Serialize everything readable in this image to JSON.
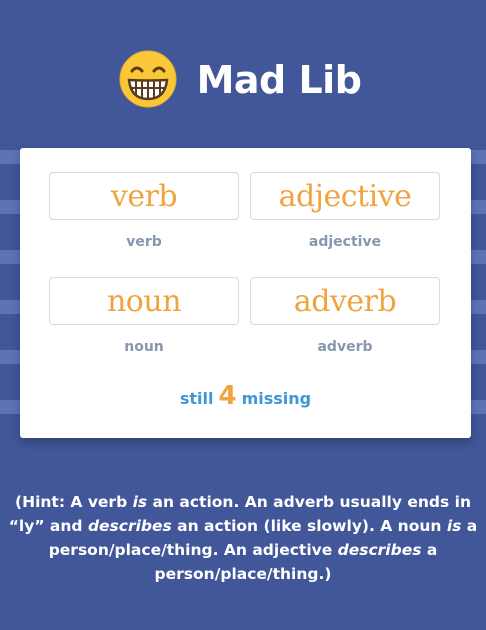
{
  "header": {
    "icon": "grinning-face-icon",
    "title": "Mad Lib"
  },
  "fields": [
    {
      "value": "verb",
      "label": "verb"
    },
    {
      "value": "adjective",
      "label": "adjective"
    },
    {
      "value": "noun",
      "label": "noun"
    },
    {
      "value": "adverb",
      "label": "adverb"
    }
  ],
  "status": {
    "prefix": "still",
    "count": "4",
    "suffix": "missing"
  },
  "hint": {
    "s1": "(Hint: A verb ",
    "s2": "is",
    "s3": " an action. An adverb usually ends in “ly” and ",
    "s4": "describes",
    "s5": " an action (like slowly). A noun ",
    "s6": "is",
    "s7": " a person/place/thing. An adjective ",
    "s8": "describes",
    "s9": " a person/place/thing.)"
  },
  "colors": {
    "background": "#42569a",
    "stripe": "#6378bb",
    "word_accent": "#f0a441",
    "status_text": "#3f98d3",
    "label_text": "#8797b0"
  }
}
